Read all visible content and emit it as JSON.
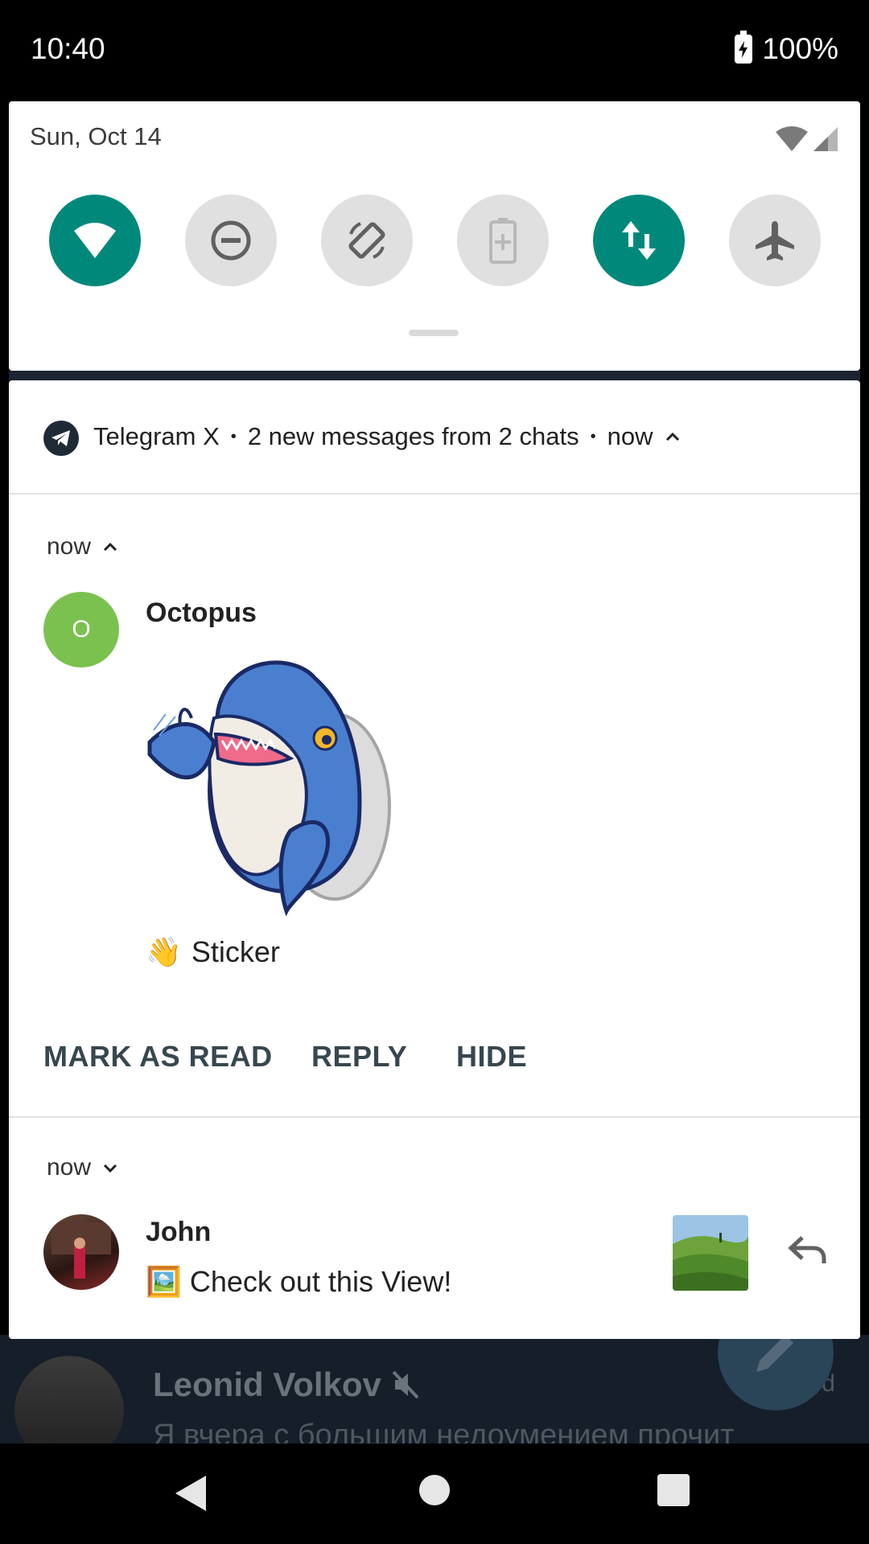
{
  "status_bar": {
    "time": "10:40",
    "battery": "100%"
  },
  "quick_settings": {
    "date": "Sun, Oct 14",
    "tiles": [
      {
        "name": "wifi",
        "icon": "wifi-icon",
        "active": true
      },
      {
        "name": "do-not-disturb",
        "icon": "do-not-disturb-icon",
        "active": false
      },
      {
        "name": "auto-rotate",
        "icon": "auto-rotate-icon",
        "active": false
      },
      {
        "name": "battery-saver",
        "icon": "battery-saver-icon",
        "active": false
      },
      {
        "name": "mobile-data",
        "icon": "data-transfer-icon",
        "active": true
      },
      {
        "name": "airplane-mode",
        "icon": "airplane-icon",
        "active": false
      }
    ],
    "accent_color": "#00897b"
  },
  "notification": {
    "app_name": "Telegram X",
    "summary": "2 new messages from 2 chats",
    "time": "now",
    "groups": [
      {
        "time": "now",
        "sender": "Octopus",
        "avatar_letter": "O",
        "avatar_color": "#7bc14f",
        "emoji": "👋",
        "message": "Sticker",
        "actions": [
          "MARK AS READ",
          "REPLY",
          "HIDE"
        ]
      },
      {
        "time": "now",
        "sender": "John",
        "emoji": "🖼️",
        "message": "Check out this View!"
      }
    ]
  },
  "background_chat": {
    "name": "Leonid Volkov",
    "preview": "Я вчера с большим недоумением прочит",
    "side_text": "ed"
  }
}
